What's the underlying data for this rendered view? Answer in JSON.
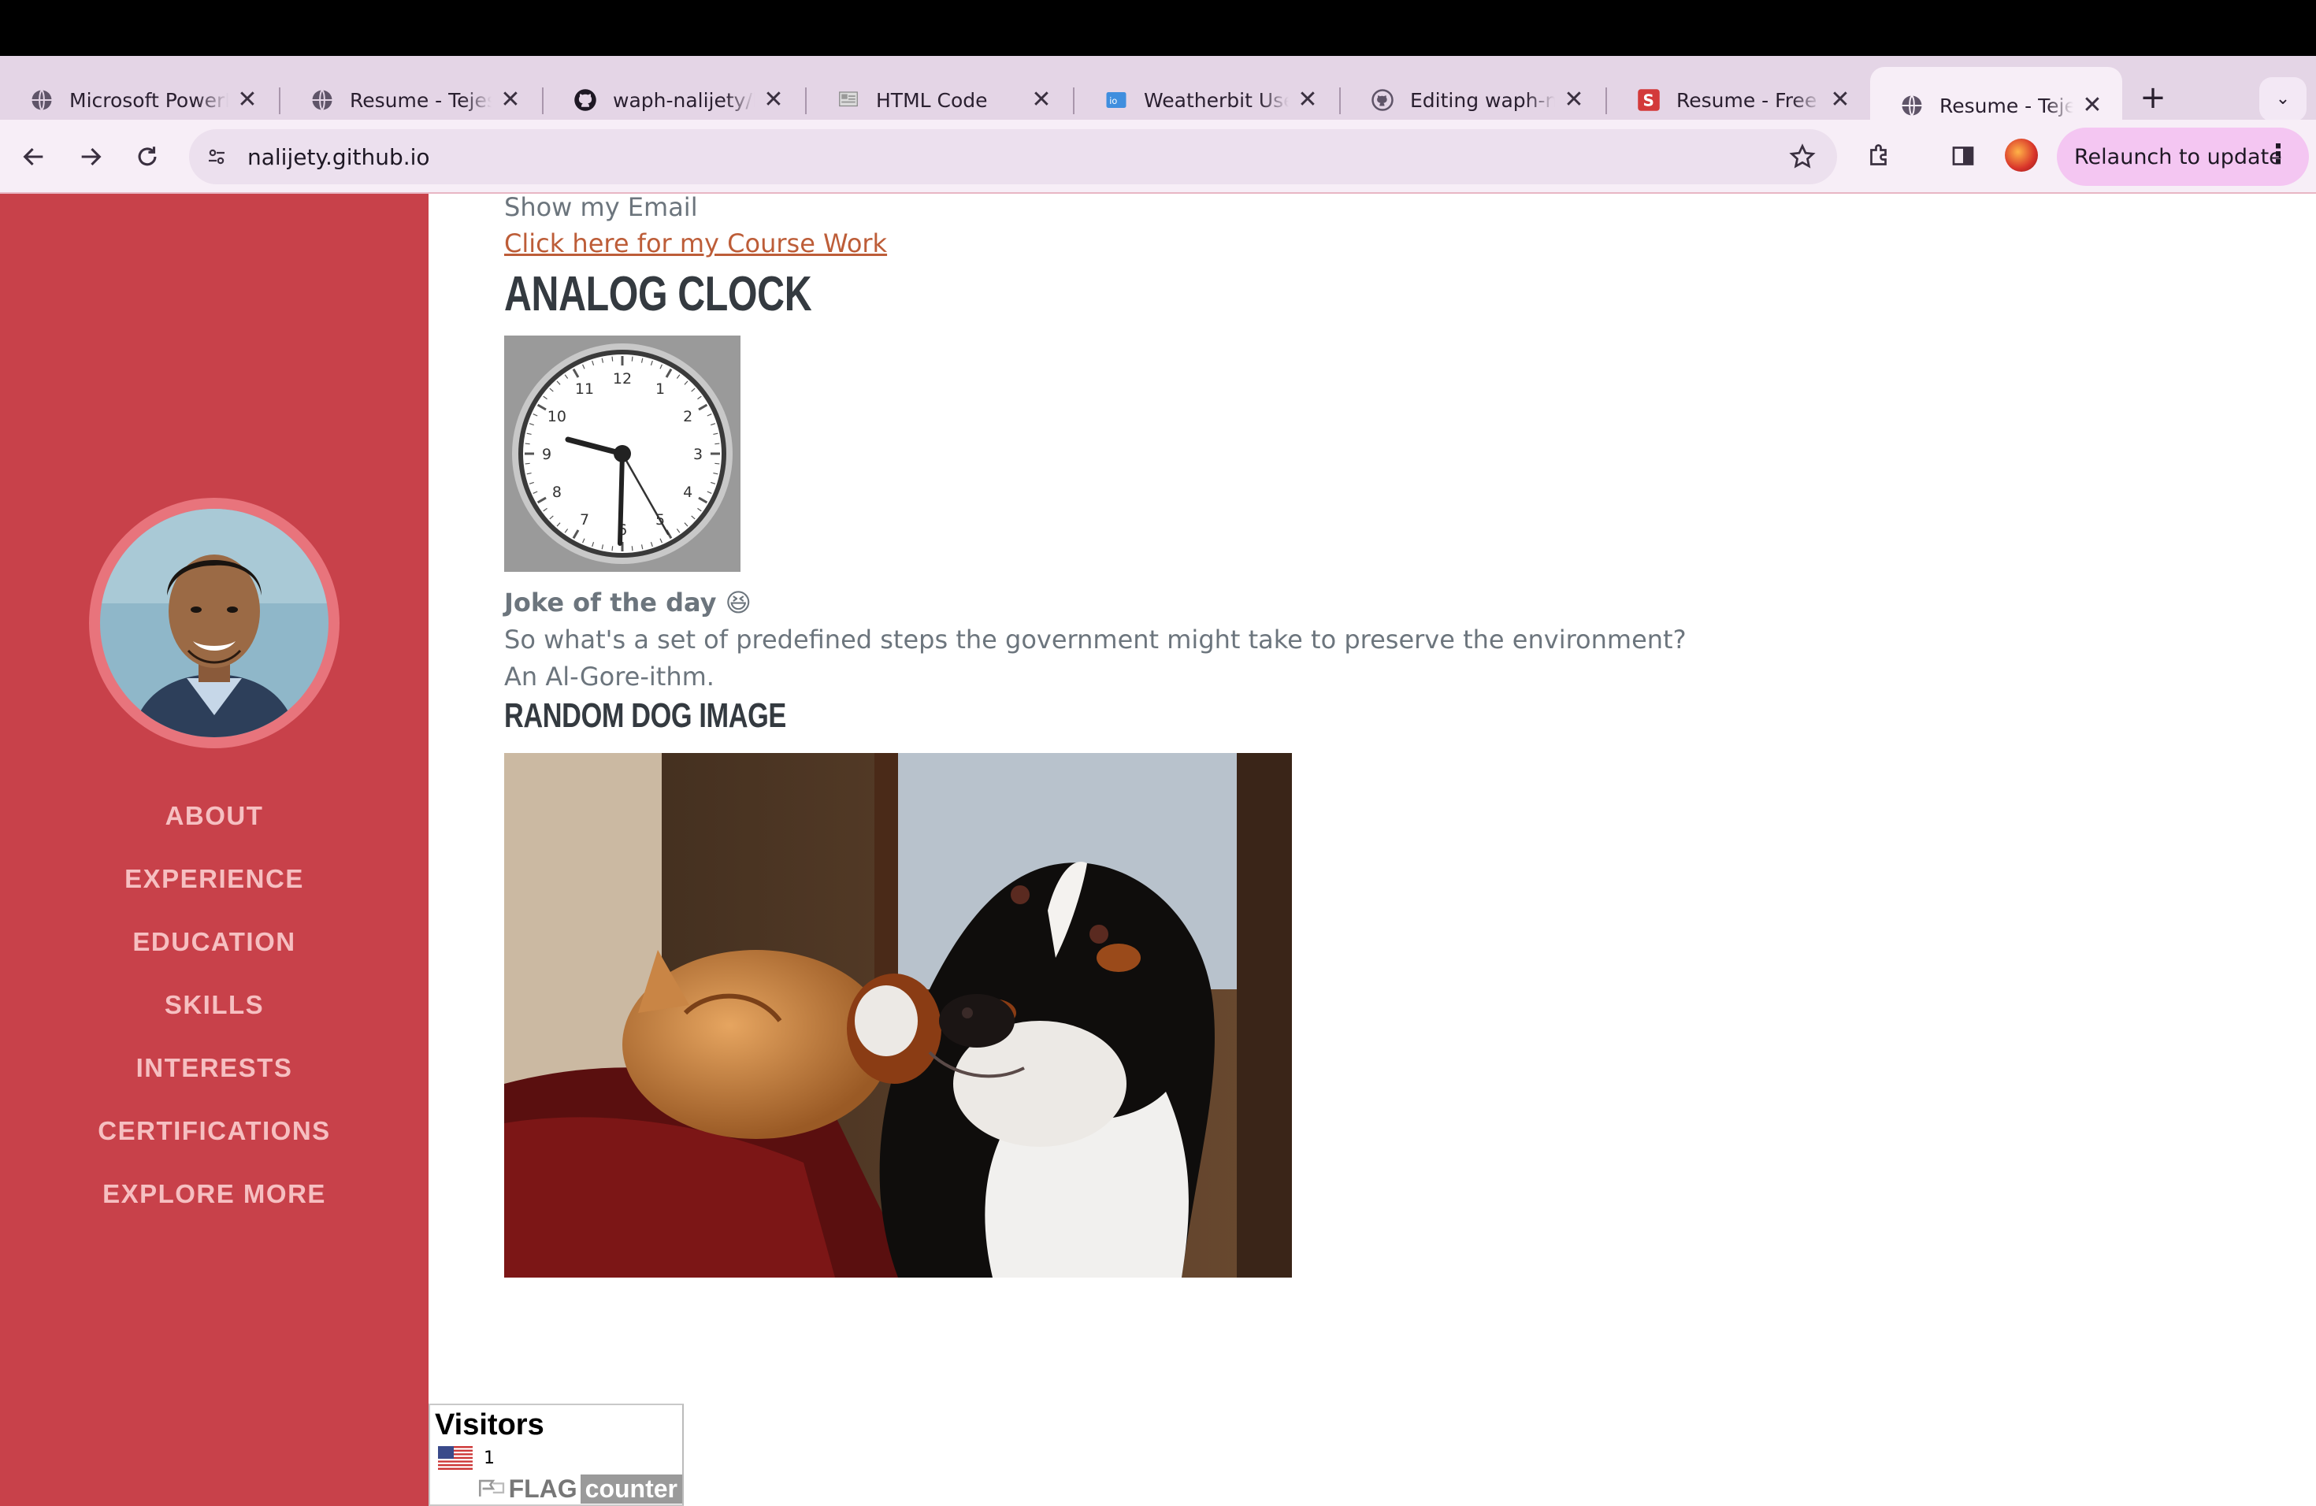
{
  "browser": {
    "tabs": [
      {
        "title": "Microsoft PowerPoint",
        "icon": "globe-icon"
      },
      {
        "title": "Resume - Tejeswar",
        "icon": "globe-icon"
      },
      {
        "title": "waph-nalijety/lab",
        "icon": "github-icon"
      },
      {
        "title": "HTML Code",
        "icon": "flag-counter-icon"
      },
      {
        "title": "Weatherbit User",
        "icon": "weatherbit-icon"
      },
      {
        "title": "Editing waph-nalijety",
        "icon": "github-icon"
      },
      {
        "title": "Resume - Free Resume",
        "icon": "s-logo-icon"
      },
      {
        "title": "Resume - Tejeswar",
        "icon": "globe-icon",
        "active": true
      }
    ],
    "close_glyph": "✕",
    "new_tab_glyph": "+",
    "tab_menu_glyph": "⌄",
    "url": "nalijety.github.io",
    "relaunch_label": "Relaunch to update",
    "relaunch_menu_glyph": "⋮"
  },
  "sidebar": {
    "nav_items": [
      "ABOUT",
      "EXPERIENCE",
      "EDUCATION",
      "SKILLS",
      "INTERESTS",
      "CERTIFICATIONS",
      "EXPLORE MORE"
    ]
  },
  "main": {
    "email_text": "Show my Email",
    "course_link": "Click here for my Course Work",
    "clock_heading": "ANALOG CLOCK",
    "clock_numbers": [
      "12",
      "1",
      "2",
      "3",
      "4",
      "5",
      "6",
      "7",
      "8",
      "9",
      "10",
      "11"
    ],
    "joke_title": "Joke of the day 😆",
    "joke_question": "So what's a set of predefined steps the government might take to preserve the environment?",
    "joke_answer": "An Al-Gore-ithm.",
    "dog_heading": "RANDOM DOG IMAGE"
  },
  "flag_counter": {
    "title": "Visitors",
    "count": "1",
    "brand_flag": "FLAG",
    "brand_counter": "counter"
  },
  "colors": {
    "sidebar": "#c8414a",
    "nav_text": "#f6bfc1",
    "link": "#bd5d38",
    "heading": "#343a40",
    "body_text": "#6c757d"
  }
}
